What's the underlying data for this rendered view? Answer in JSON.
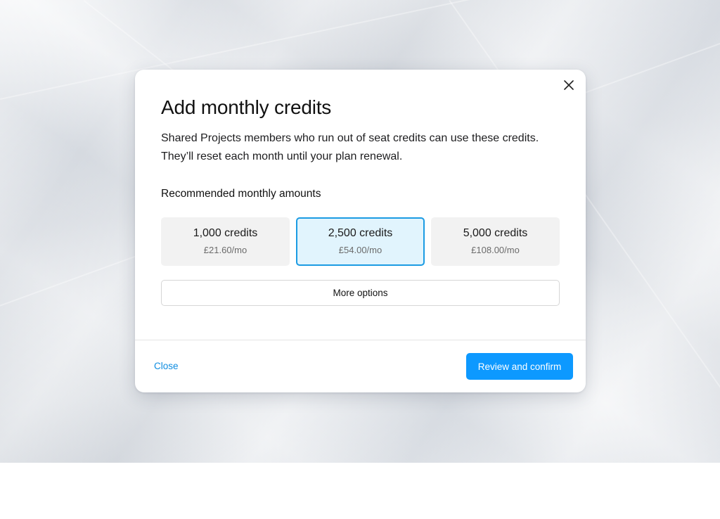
{
  "dialog": {
    "title": "Add monthly credits",
    "description": "Shared Projects members who run out of seat credits can use these credits. They’ll reset each month until your plan renewal.",
    "section_label": "Recommended monthly amounts",
    "options": [
      {
        "amount": "1,000 credits",
        "price": "£21.60/mo",
        "selected": false
      },
      {
        "amount": "2,500 credits",
        "price": "£54.00/mo",
        "selected": true
      },
      {
        "amount": "5,000 credits",
        "price": "£108.00/mo",
        "selected": false
      }
    ],
    "more_options_label": "More options",
    "close_label": "Close",
    "confirm_label": "Review and confirm",
    "close_icon": "close-icon"
  },
  "colors": {
    "accent": "#0d99ff",
    "link": "#0d8ce0",
    "selected_bg": "#e1f4fd",
    "selected_border": "#1b9be3",
    "option_bg": "#f2f2f2"
  }
}
